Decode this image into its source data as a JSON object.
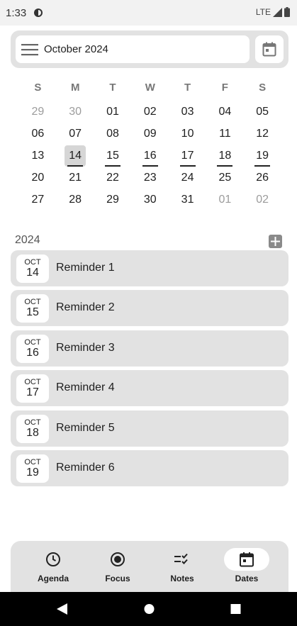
{
  "status_bar": {
    "time": "1:33",
    "network": "LTE"
  },
  "header": {
    "month_title": "October 2024"
  },
  "calendar": {
    "weekdays": [
      "S",
      "M",
      "T",
      "W",
      "T",
      "F",
      "S"
    ],
    "weeks": [
      [
        {
          "d": "29",
          "muted": true
        },
        {
          "d": "30",
          "muted": true
        },
        {
          "d": "01"
        },
        {
          "d": "02"
        },
        {
          "d": "03"
        },
        {
          "d": "04"
        },
        {
          "d": "05"
        }
      ],
      [
        {
          "d": "06"
        },
        {
          "d": "07"
        },
        {
          "d": "08"
        },
        {
          "d": "09"
        },
        {
          "d": "10"
        },
        {
          "d": "11"
        },
        {
          "d": "12"
        }
      ],
      [
        {
          "d": "13"
        },
        {
          "d": "14",
          "selected": true,
          "marked": true
        },
        {
          "d": "15",
          "marked": true
        },
        {
          "d": "16",
          "marked": true
        },
        {
          "d": "17",
          "marked": true
        },
        {
          "d": "18",
          "marked": true
        },
        {
          "d": "19",
          "marked": true
        }
      ],
      [
        {
          "d": "20"
        },
        {
          "d": "21"
        },
        {
          "d": "22"
        },
        {
          "d": "23"
        },
        {
          "d": "24"
        },
        {
          "d": "25"
        },
        {
          "d": "26"
        }
      ],
      [
        {
          "d": "27"
        },
        {
          "d": "28"
        },
        {
          "d": "29"
        },
        {
          "d": "30"
        },
        {
          "d": "31"
        },
        {
          "d": "01",
          "muted": true
        },
        {
          "d": "02",
          "muted": true
        }
      ]
    ]
  },
  "list": {
    "year": "2024",
    "reminders": [
      {
        "month": "OCT",
        "day": "14",
        "title": "Reminder 1"
      },
      {
        "month": "OCT",
        "day": "15",
        "title": "Reminder 2"
      },
      {
        "month": "OCT",
        "day": "16",
        "title": "Reminder 3"
      },
      {
        "month": "OCT",
        "day": "17",
        "title": "Reminder 4"
      },
      {
        "month": "OCT",
        "day": "18",
        "title": "Reminder 5"
      },
      {
        "month": "OCT",
        "day": "19",
        "title": "Reminder 6"
      }
    ]
  },
  "bottom_nav": {
    "items": [
      {
        "label": "Agenda",
        "icon": "clock-icon",
        "active": false
      },
      {
        "label": "Focus",
        "icon": "focus-icon",
        "active": false
      },
      {
        "label": "Notes",
        "icon": "checklist-icon",
        "active": false
      },
      {
        "label": "Dates",
        "icon": "calendar-icon",
        "active": true
      }
    ]
  },
  "colors": {
    "surface": "#e2e2e2",
    "selected_day": "#d6d6d6",
    "muted_text": "#9c9c9c",
    "add_button": "#8a8a8a"
  }
}
